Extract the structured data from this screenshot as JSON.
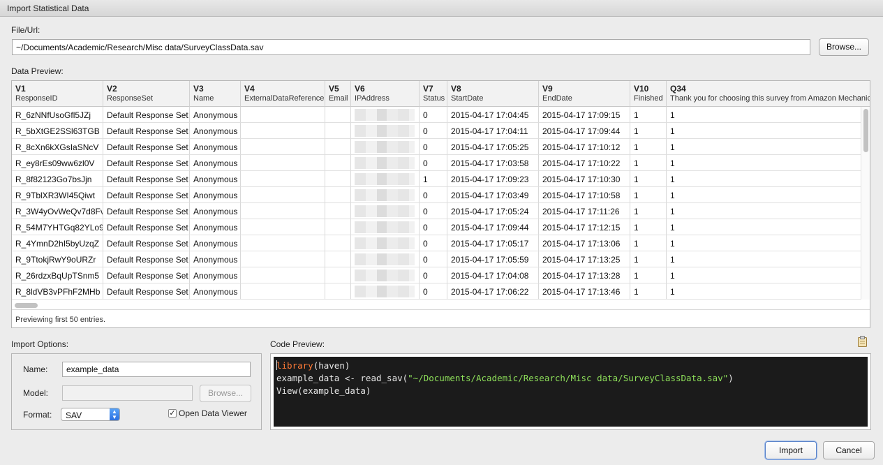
{
  "window": {
    "title": "Import Statistical Data"
  },
  "file": {
    "label": "File/Url:",
    "value": "~/Documents/Academic/Research/Misc data/SurveyClassData.sav",
    "browse_label": "Browse..."
  },
  "preview": {
    "label": "Data Preview:",
    "status": "Previewing first 50 entries.",
    "columns": [
      {
        "v": "V1",
        "name": "ResponseID"
      },
      {
        "v": "V2",
        "name": "ResponseSet"
      },
      {
        "v": "V3",
        "name": "Name"
      },
      {
        "v": "V4",
        "name": "ExternalDataReference"
      },
      {
        "v": "V5",
        "name": "Email"
      },
      {
        "v": "V6",
        "name": "IPAddress"
      },
      {
        "v": "V7",
        "name": "Status"
      },
      {
        "v": "V8",
        "name": "StartDate"
      },
      {
        "v": "V9",
        "name": "EndDate"
      },
      {
        "v": "V10",
        "name": "Finished"
      },
      {
        "v": "Q34",
        "name": "Thank you for choosing this survey from Amazon Mechanical Turk"
      }
    ],
    "rows": [
      [
        "R_6zNNfUsoGfl5JZj",
        "Default Response Set",
        "Anonymous",
        "",
        "",
        "",
        "0",
        "2015-04-17 17:04:45",
        "2015-04-17 17:09:15",
        "1",
        "1"
      ],
      [
        "R_5bXtGE2SSl63TGB",
        "Default Response Set",
        "Anonymous",
        "",
        "",
        "",
        "0",
        "2015-04-17 17:04:11",
        "2015-04-17 17:09:44",
        "1",
        "1"
      ],
      [
        "R_8cXn6kXGsIaSNcV",
        "Default Response Set",
        "Anonymous",
        "",
        "",
        "",
        "0",
        "2015-04-17 17:05:25",
        "2015-04-17 17:10:12",
        "1",
        "1"
      ],
      [
        "R_ey8rEs09ww6zl0V",
        "Default Response Set",
        "Anonymous",
        "",
        "",
        "",
        "0",
        "2015-04-17 17:03:58",
        "2015-04-17 17:10:22",
        "1",
        "1"
      ],
      [
        "R_8f82123Go7bsJjn",
        "Default Response Set",
        "Anonymous",
        "",
        "",
        "",
        "1",
        "2015-04-17 17:09:23",
        "2015-04-17 17:10:30",
        "1",
        "1"
      ],
      [
        "R_9TblXR3WI45Qiwt",
        "Default Response Set",
        "Anonymous",
        "",
        "",
        "",
        "0",
        "2015-04-17 17:03:49",
        "2015-04-17 17:10:58",
        "1",
        "1"
      ],
      [
        "R_3W4yOvWeQv7d8Fv",
        "Default Response Set",
        "Anonymous",
        "",
        "",
        "",
        "0",
        "2015-04-17 17:05:24",
        "2015-04-17 17:11:26",
        "1",
        "1"
      ],
      [
        "R_54M7YHTGq82YLo9",
        "Default Response Set",
        "Anonymous",
        "",
        "",
        "",
        "0",
        "2015-04-17 17:09:44",
        "2015-04-17 17:12:15",
        "1",
        "1"
      ],
      [
        "R_4YmnD2hI5byUzqZ",
        "Default Response Set",
        "Anonymous",
        "",
        "",
        "",
        "0",
        "2015-04-17 17:05:17",
        "2015-04-17 17:13:06",
        "1",
        "1"
      ],
      [
        "R_9TtokjRwY9oURZr",
        "Default Response Set",
        "Anonymous",
        "",
        "",
        "",
        "0",
        "2015-04-17 17:05:59",
        "2015-04-17 17:13:25",
        "1",
        "1"
      ],
      [
        "R_26rdzxBqUpTSnm5",
        "Default Response Set",
        "Anonymous",
        "",
        "",
        "",
        "0",
        "2015-04-17 17:04:08",
        "2015-04-17 17:13:28",
        "1",
        "1"
      ],
      [
        "R_8ldVB3vPFhF2MHb",
        "Default Response Set",
        "Anonymous",
        "",
        "",
        "",
        "0",
        "2015-04-17 17:06:22",
        "2015-04-17 17:13:46",
        "1",
        "1"
      ]
    ]
  },
  "options": {
    "label": "Import Options:",
    "name_label": "Name:",
    "name_value": "example_data",
    "model_label": "Model:",
    "model_value": "",
    "model_browse_label": "Browse...",
    "format_label": "Format:",
    "format_value": "SAV",
    "open_viewer_label": "Open Data Viewer",
    "open_viewer_checked": true
  },
  "code": {
    "label": "Code Preview:",
    "line1_kw": "library",
    "line1_rest": "(haven)",
    "line2_pre": "example_data <- read_sav(",
    "line2_str": "\"~/Documents/Academic/Research/Misc data/SurveyClassData.sav\"",
    "line2_post": ")",
    "line3": "View(example_data)"
  },
  "actions": {
    "import_label": "Import",
    "cancel_label": "Cancel"
  }
}
